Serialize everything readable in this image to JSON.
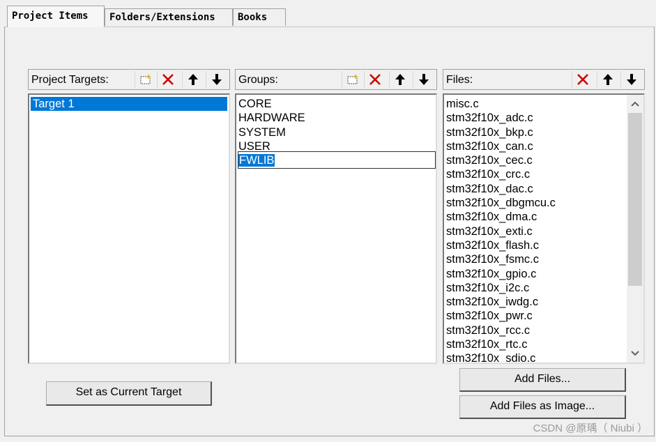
{
  "tabs": [
    "Project Items",
    "Folders/Extensions",
    "Books"
  ],
  "targets": {
    "header": "Project Targets:",
    "items": [
      "Target 1"
    ]
  },
  "groups": {
    "header": "Groups:",
    "items": [
      "CORE",
      "HARDWARE",
      "SYSTEM",
      "USER",
      "FWLIB"
    ]
  },
  "files": {
    "header": "Files:",
    "items": [
      "misc.c",
      "stm32f10x_adc.c",
      "stm32f10x_bkp.c",
      "stm32f10x_can.c",
      "stm32f10x_cec.c",
      "stm32f10x_crc.c",
      "stm32f10x_dac.c",
      "stm32f10x_dbgmcu.c",
      "stm32f10x_dma.c",
      "stm32f10x_exti.c",
      "stm32f10x_flash.c",
      "stm32f10x_fsmc.c",
      "stm32f10x_gpio.c",
      "stm32f10x_i2c.c",
      "stm32f10x_iwdg.c",
      "stm32f10x_pwr.c",
      "stm32f10x_rcc.c",
      "stm32f10x_rtc.c",
      "stm32f10x_sdio.c"
    ]
  },
  "buttons": {
    "set_target": "Set as Current Target",
    "add_files": "Add Files...",
    "add_image": "Add Files as Image..."
  },
  "watermark": "CSDN @原瑀（ Niubi ）",
  "colors": {
    "selection": "#0078d7",
    "delete": "#cc0000"
  }
}
